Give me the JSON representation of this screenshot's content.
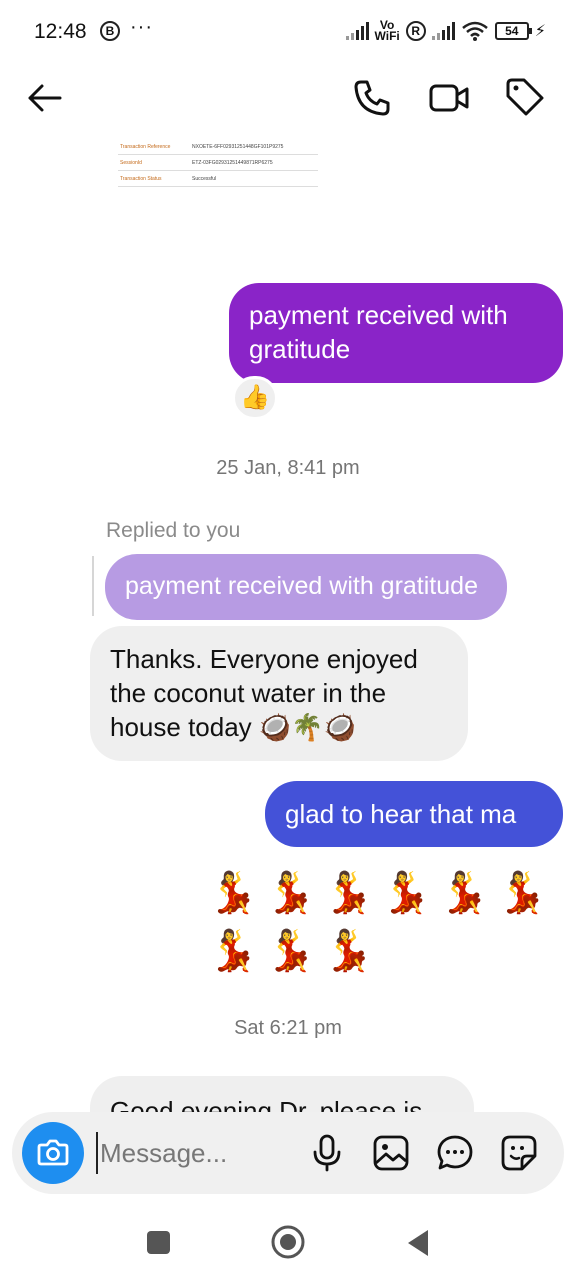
{
  "status_bar": {
    "time": "12:48",
    "b_badge": "B",
    "dots": "···",
    "vo": "Vo",
    "wifi_label": "WiFi",
    "r_badge": "R",
    "battery": "54"
  },
  "screenshot_image": {
    "rows": [
      {
        "label": "Transaction Reference",
        "value": "NXOETE-6FF02931251448GF101P9275"
      },
      {
        "label": "SessionId",
        "value": "ETZ-03FG02931251449871RP6275"
      },
      {
        "label": "Transaction Status",
        "value": "Successful"
      }
    ]
  },
  "messages": {
    "out1": "payment received with gratitude",
    "reaction": "👍",
    "time1": "25 Jan, 8:41 pm",
    "replied_label": "Replied to you",
    "reply_quote": "payment received with gratitude",
    "in1": "Thanks. Everyone enjoyed the coconut water in the house today 🥥🌴🥥",
    "out2": "glad to hear that ma",
    "dancers_row1": "💃💃💃💃💃💃",
    "dancers_row2": "💃💃💃",
    "time2": "Sat 6:21 pm",
    "in2_partial": "Good evening Dr. please is"
  },
  "composer": {
    "placeholder": "Message..."
  },
  "colors": {
    "outgoing_purple": "#8a24c8",
    "outgoing_blue": "#4452d8",
    "reply_quote": "#b79be3",
    "incoming_gray": "#efefef",
    "camera_button": "#1e8ef0"
  }
}
